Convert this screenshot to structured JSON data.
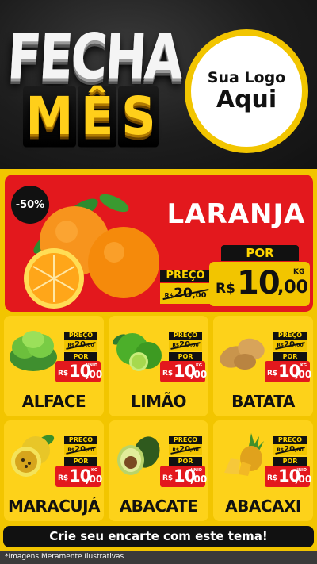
{
  "header": {
    "title_line1": "FECHA",
    "title_line2_letters": [
      "M",
      "Ê",
      "S"
    ],
    "logo_line1": "Sua Logo",
    "logo_line2": "Aqui"
  },
  "featured": {
    "discount": "-50%",
    "name": "LARANJA",
    "preco_label": "PREÇO",
    "old_currency": "R$",
    "old_int": "20",
    "old_dec": ",00",
    "por_label": "POR",
    "new_currency": "R$",
    "new_int": "10",
    "new_dec": ",00",
    "unit": "KG"
  },
  "products": [
    {
      "name": "ALFACE",
      "preco_label": "PREÇO",
      "old_currency": "R$",
      "old_int": "20",
      "old_dec": ",00",
      "por_label": "POR",
      "new_currency": "R$",
      "new_int": "10",
      "new_dec": ",00",
      "unit": "UNID"
    },
    {
      "name": "LIMÃO",
      "preco_label": "PREÇO",
      "old_currency": "R$",
      "old_int": "20",
      "old_dec": ",00",
      "por_label": "POR",
      "new_currency": "R$",
      "new_int": "10",
      "new_dec": ",00",
      "unit": "KG"
    },
    {
      "name": "BATATA",
      "preco_label": "PREÇO",
      "old_currency": "R$",
      "old_int": "20",
      "old_dec": ",00",
      "por_label": "POR",
      "new_currency": "R$",
      "new_int": "10",
      "new_dec": ",00",
      "unit": "KG"
    },
    {
      "name": "MARACUJÁ",
      "preco_label": "PREÇO",
      "old_currency": "R$",
      "old_int": "20",
      "old_dec": ",00",
      "por_label": "POR",
      "new_currency": "R$",
      "new_int": "10",
      "new_dec": ",00",
      "unit": "KG"
    },
    {
      "name": "ABACATE",
      "preco_label": "PREÇO",
      "old_currency": "R$",
      "old_int": "20",
      "old_dec": ",00",
      "por_label": "POR",
      "new_currency": "R$",
      "new_int": "10",
      "new_dec": ",00",
      "unit": "UNID"
    },
    {
      "name": "ABACAXI",
      "preco_label": "PREÇO",
      "old_currency": "R$",
      "old_int": "20",
      "old_dec": ",00",
      "por_label": "POR",
      "new_currency": "R$",
      "new_int": "10",
      "new_dec": ",00",
      "unit": "UNID"
    }
  ],
  "footer": {
    "cta": "Crie seu encarte com este tema!",
    "disclaimer": "*Imagens Meramente Ilustrativas"
  },
  "colors": {
    "red": "#e3181d",
    "yellow": "#f2c500",
    "black": "#111111"
  }
}
